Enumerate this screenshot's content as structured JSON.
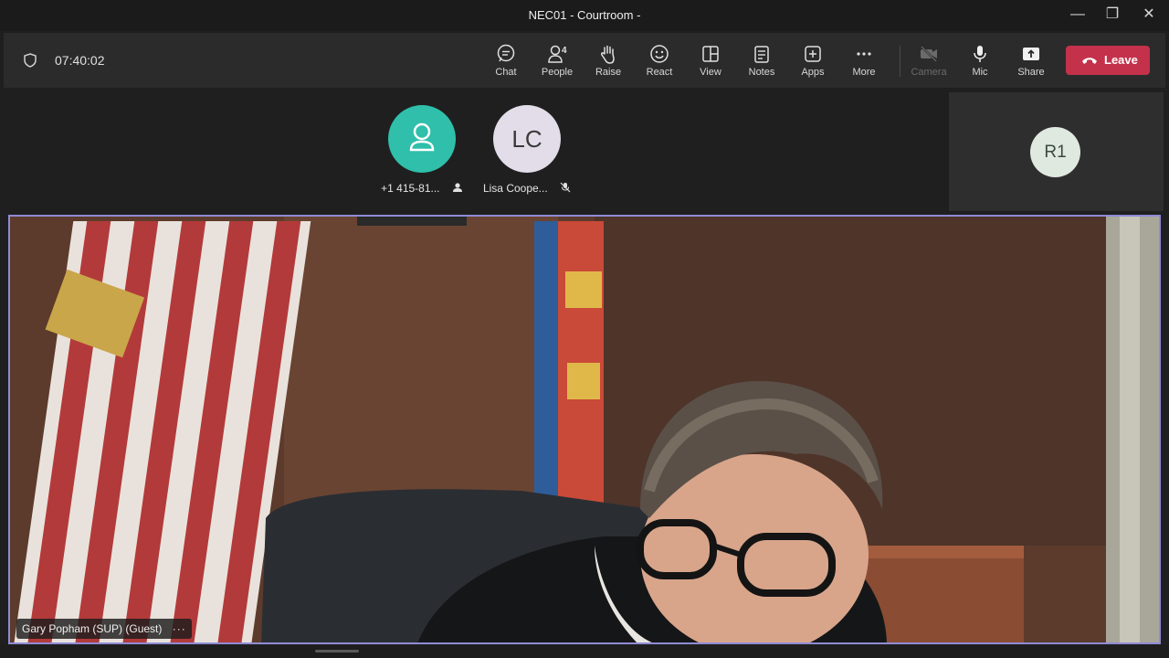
{
  "window": {
    "title": "NEC01 - Courtroom -",
    "controls": [
      {
        "name": "minimize-icon",
        "glyph": "—"
      },
      {
        "name": "restore-icon",
        "glyph": "❐"
      },
      {
        "name": "close-icon",
        "glyph": "✕"
      }
    ]
  },
  "meeting": {
    "timer": "07:40:02",
    "people_count": "4"
  },
  "toolbar": {
    "chat": "Chat",
    "people": "People",
    "raise": "Raise",
    "react": "React",
    "view": "View",
    "notes": "Notes",
    "apps": "Apps",
    "more": "More",
    "camera": "Camera",
    "mic": "Mic",
    "share": "Share",
    "leave": "Leave"
  },
  "participants": [
    {
      "name": "+1 415-81...",
      "avatar": "person-icon",
      "indicator": "phone-user-icon"
    },
    {
      "name": "Lisa Coope...",
      "initials": "LC",
      "indicator": "mic-off-icon"
    }
  ],
  "side_tile": {
    "initials": "R1"
  },
  "main_video": {
    "speaker": "Gary Popham (SUP) (Guest)",
    "more": "···"
  },
  "colors": {
    "leave": "#c4314b",
    "active_border": "#8f8bd6",
    "avatar_teal": "#2fbfaa"
  }
}
